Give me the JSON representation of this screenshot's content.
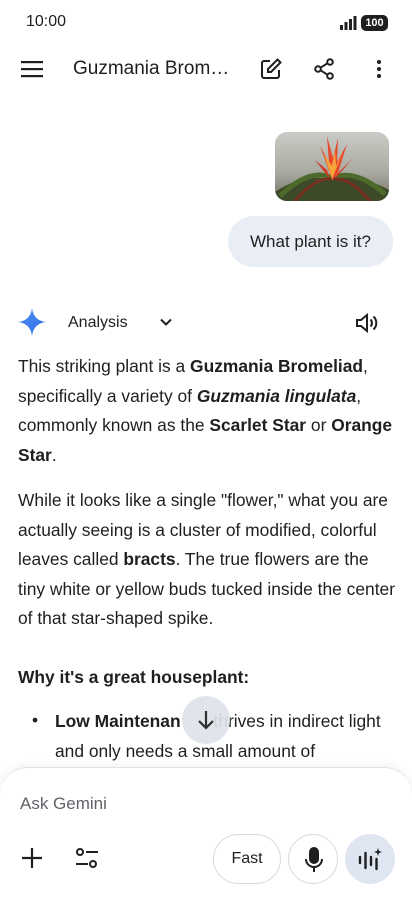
{
  "status_bar": {
    "time": "10:00",
    "battery": "100"
  },
  "header": {
    "title": "Guzmania Bromel..."
  },
  "user_message": {
    "text": "What plant is it?"
  },
  "response": {
    "mode_label": "Analysis",
    "paragraph1": {
      "t1": "This striking plant is a ",
      "b1": "Guzmania Bromeliad",
      "t2": ", specifically a variety of ",
      "bi1": "Guzmania lingulata",
      "t3": ", commonly known as the ",
      "b2": "Scarlet Star",
      "t4": " or ",
      "b3": "Orange Star",
      "t5": "."
    },
    "paragraph2": {
      "t1": "While it looks like a single \"flower,\" what you are actually seeing is a cluster of modified, colorful leaves called ",
      "b1": "bracts",
      "t2": ". The true flowers are the tiny white or yellow buds tucked inside the center of that star-shaped spike."
    },
    "section_heading": "Why it's a great houseplant:",
    "bullet1": {
      "bold": "Low Maintenan",
      "text": " thrives in indirect light and only needs a small amount of"
    }
  },
  "composer": {
    "placeholder": "Ask Gemini",
    "fast_label": "Fast"
  },
  "colors": {
    "bubble": "#e9eef6",
    "gemini_blue": "#4285f4",
    "live_button": "#dfe6f2"
  }
}
